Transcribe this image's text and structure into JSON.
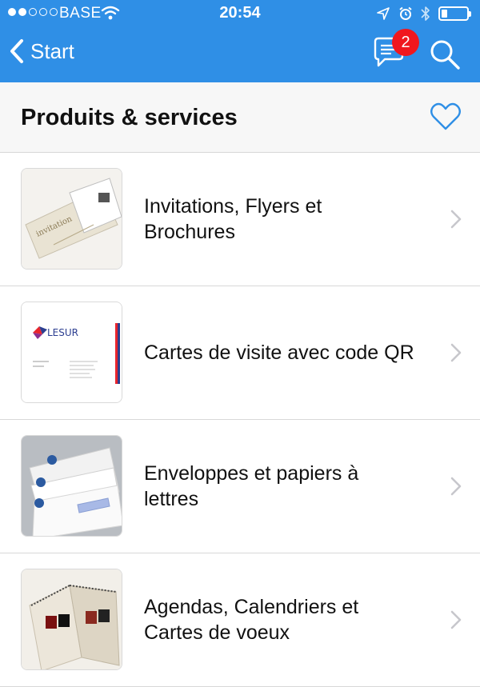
{
  "status_bar": {
    "carrier": "BASE",
    "time": "20:54",
    "signal_bars_filled": 2,
    "signal_bars_total": 5,
    "battery_level": 0.2
  },
  "nav": {
    "back_label": "Start",
    "chat_badge": "2",
    "bg_color": "#2f8fe6"
  },
  "section": {
    "title": "Produits & services"
  },
  "items": [
    {
      "label": "Invitations, Flyers et Brochures",
      "thumb_icon": "invitation-card-thumbnail"
    },
    {
      "label": "Cartes de visite avec code QR",
      "thumb_icon": "business-card-thumbnail",
      "thumb_text": "LESUR"
    },
    {
      "label": "Enveloppes et papiers à lettres",
      "thumb_icon": "envelopes-thumbnail"
    },
    {
      "label": "Agendas, Calendriers et Cartes de voeux",
      "thumb_icon": "calendar-thumbnail"
    }
  ]
}
